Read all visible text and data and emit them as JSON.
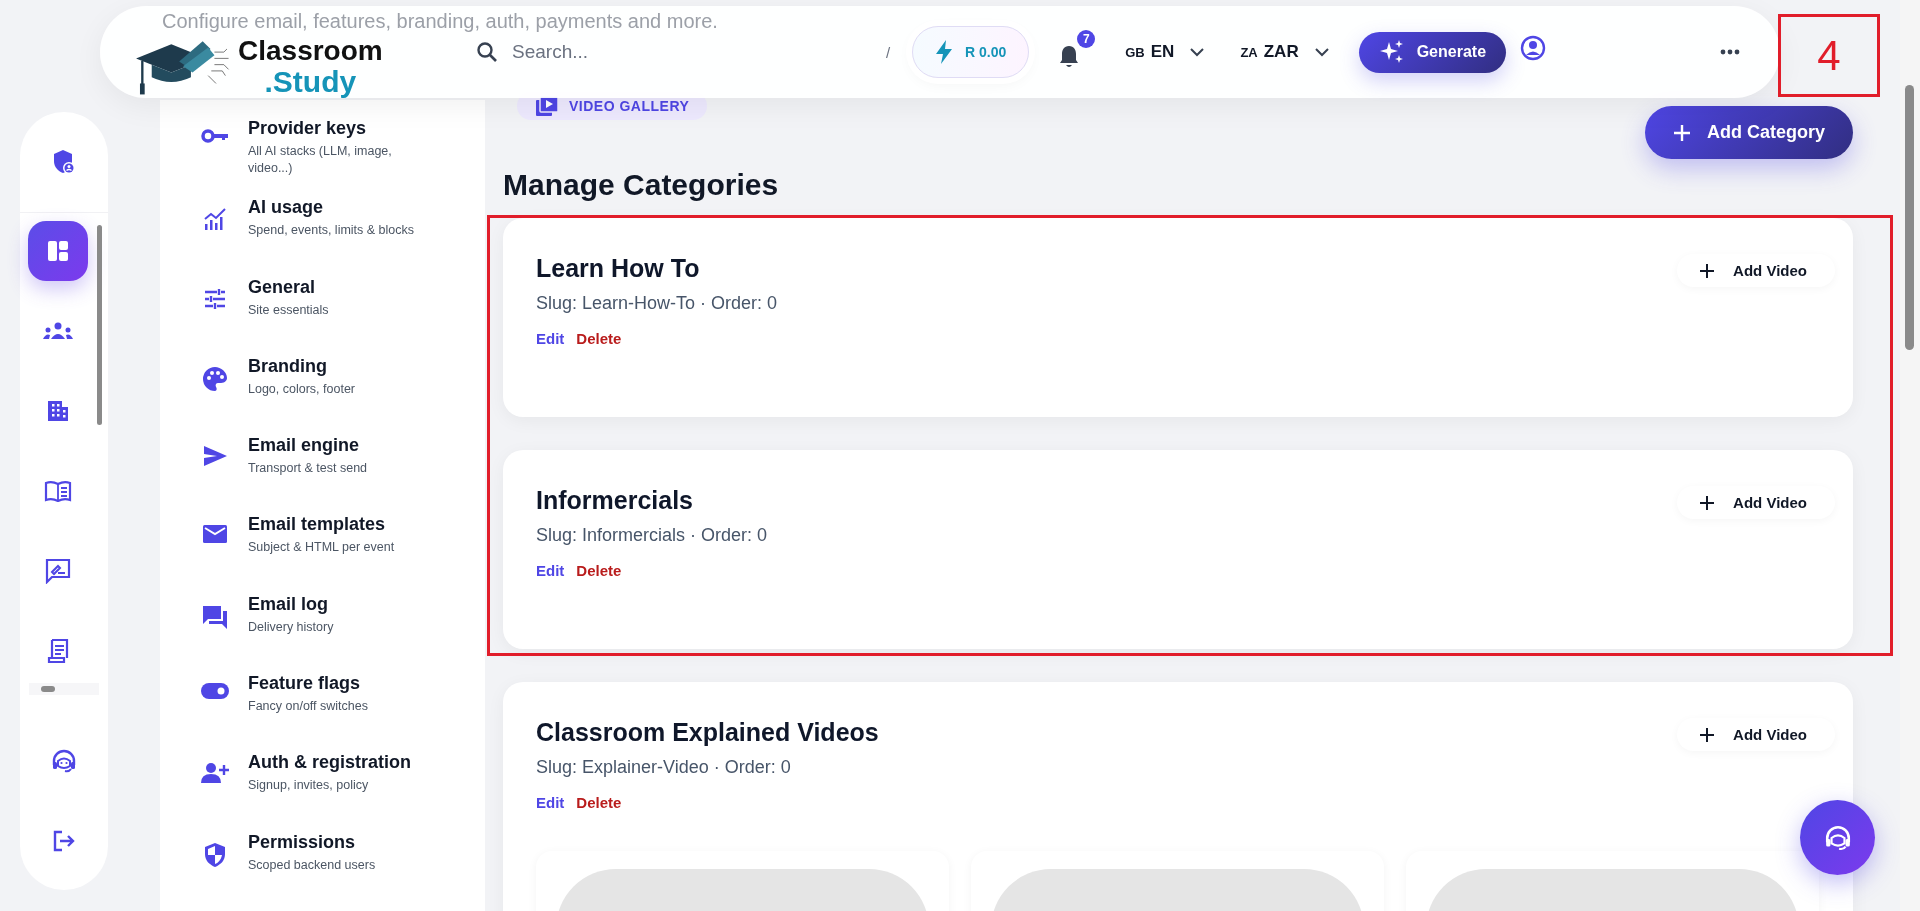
{
  "header_subtitle": "Configure email, features, branding, auth, payments and more.",
  "logo": {
    "line1": "Classroom",
    "line2": ".Study"
  },
  "search": {
    "placeholder": "Search...",
    "shortcut": "/"
  },
  "credits": "R 0.00",
  "notifications": {
    "count": "7"
  },
  "language": {
    "flag": "GB",
    "code": "EN"
  },
  "currency": {
    "flag": "ZA",
    "code": "ZAR"
  },
  "generate_button": "Generate",
  "annotation_label": "4",
  "rail": [
    {
      "kind": "shield-user",
      "selected": false
    },
    {
      "kind": "dashboard",
      "selected": true
    },
    {
      "kind": "team",
      "selected": false
    },
    {
      "kind": "building",
      "selected": false
    },
    {
      "kind": "book",
      "selected": false
    },
    {
      "kind": "feedback",
      "selected": false
    },
    {
      "kind": "receipt",
      "selected": false
    },
    {
      "kind": "headset",
      "selected": false
    },
    {
      "kind": "logout",
      "selected": false
    }
  ],
  "settings_nav": [
    {
      "kind": "key",
      "title": "Provider keys",
      "subtitle": "All AI stacks (LLM, image, video...)"
    },
    {
      "kind": "chart",
      "title": "AI usage",
      "subtitle": "Spend, events, limits & blocks"
    },
    {
      "kind": "sliders",
      "title": "General",
      "subtitle": "Site essentials"
    },
    {
      "kind": "palette",
      "title": "Branding",
      "subtitle": "Logo, colors, footer"
    },
    {
      "kind": "send",
      "title": "Email engine",
      "subtitle": "Transport & test send"
    },
    {
      "kind": "mail",
      "title": "Email templates",
      "subtitle": "Subject & HTML per event"
    },
    {
      "kind": "chat",
      "title": "Email log",
      "subtitle": "Delivery history"
    },
    {
      "kind": "toggle",
      "title": "Feature flags",
      "subtitle": "Fancy on/off switches"
    },
    {
      "kind": "person-add",
      "title": "Auth & registration",
      "subtitle": "Signup, invites, policy"
    },
    {
      "kind": "shield",
      "title": "Permissions",
      "subtitle": "Scoped backend users"
    }
  ],
  "page": {
    "chip": "VIDEO GALLERY",
    "title": "Manage Categories",
    "add_button": "Add Category"
  },
  "categories": [
    {
      "name": "Learn How To",
      "meta": "Slug: Learn-How-To · Order: 0",
      "edit": "Edit",
      "delete": "Delete",
      "add_video": "Add Video",
      "highlighted": true
    },
    {
      "name": "Informercials",
      "meta": "Slug: Informercials · Order: 0",
      "edit": "Edit",
      "delete": "Delete",
      "add_video": "Add Video",
      "highlighted": true
    },
    {
      "name": "Classroom Explained Videos",
      "meta": "Slug: Explainer-Video · Order: 0",
      "edit": "Edit",
      "delete": "Delete",
      "add_video": "Add Video",
      "highlighted": false,
      "videos": [
        {
          "kind": "placeholder"
        },
        {
          "kind": "placeholder"
        },
        {
          "kind": "placeholder"
        }
      ]
    }
  ]
}
